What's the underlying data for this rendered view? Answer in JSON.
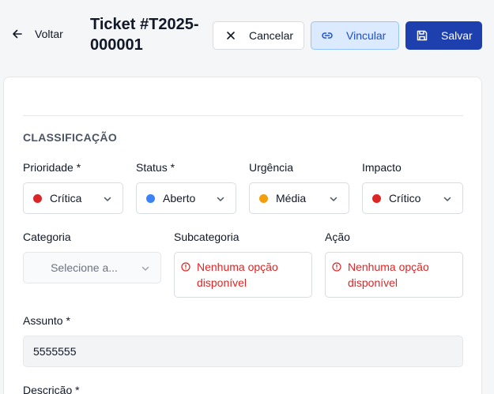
{
  "header": {
    "back_label": "Voltar",
    "title": "Ticket #T2025-000001",
    "cancel_label": "Cancelar",
    "link_label": "Vincular",
    "save_label": "Salvar"
  },
  "form": {
    "section_title": "CLASSIFICAÇÃO",
    "priority": {
      "label": "Prioridade *",
      "value": "Crítica",
      "color": "#dc2626"
    },
    "status": {
      "label": "Status *",
      "value": "Aberto",
      "color": "#3b82f6"
    },
    "urgency": {
      "label": "Urgência",
      "value": "Média",
      "color": "#f59e0b"
    },
    "impact": {
      "label": "Impacto",
      "value": "Crítico",
      "color": "#dc2626"
    },
    "category": {
      "label": "Categoria",
      "placeholder": "Selecione a..."
    },
    "subcategory": {
      "label": "Subcategoria",
      "message": "Nenhuma opção disponível"
    },
    "action": {
      "label": "Ação",
      "message": "Nenhuma opção disponível"
    },
    "subject": {
      "label": "Assunto *",
      "value": "5555555"
    },
    "description": {
      "label": "Descrição *"
    }
  }
}
